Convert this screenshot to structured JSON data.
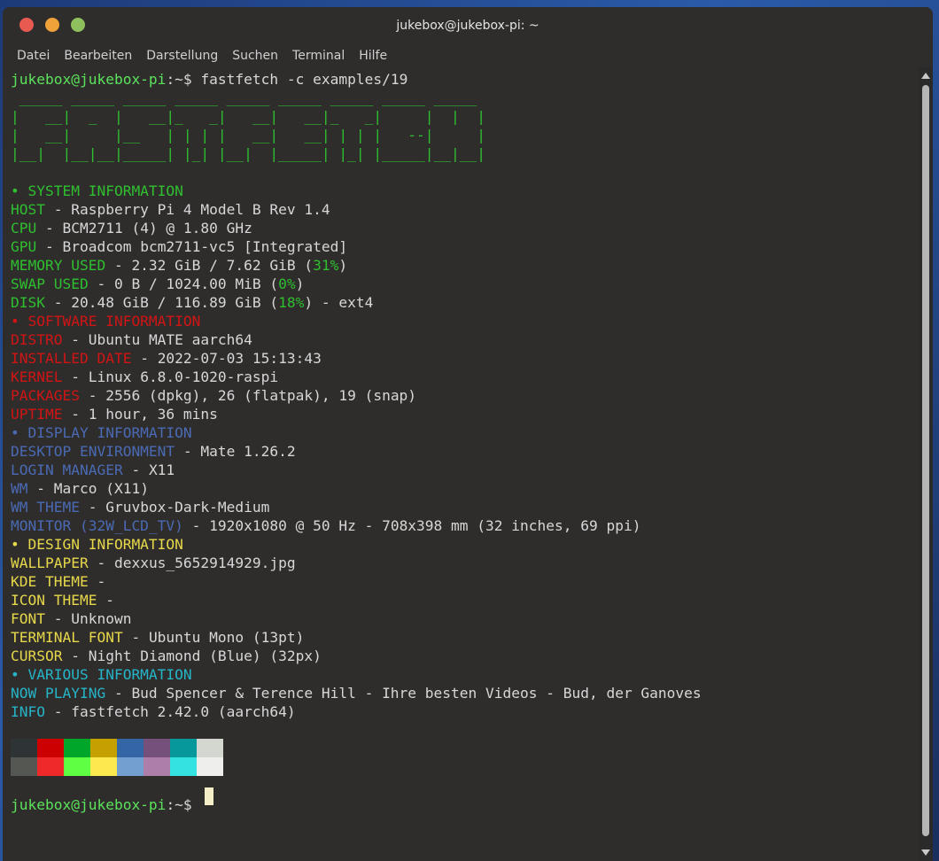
{
  "window": {
    "title": "jukebox@jukebox-pi: ~"
  },
  "menu": [
    "Datei",
    "Bearbeiten",
    "Darstellung",
    "Suchen",
    "Terminal",
    "Hilfe"
  ],
  "prompt": "jukebox@jukebox-pi",
  "prompt_suffix": ":~$",
  "command": "fastfetch -c examples/19",
  "logo": [
    " _____ _____ _____ _____ _____ _____ _____ _____ _____",
    "|   __|  _  |   __|_   _|   __|   __|_   _|     |  |  |",
    "|   __|     |__   | | | |   __|   __| | | |   --|     |",
    "|__|  |__|__|_____| |_| |__|  |_____| |_| |_____|__|__|"
  ],
  "sections": {
    "system": "• SYSTEM INFORMATION",
    "software": "• SOFTWARE INFORMATION",
    "display": "• DISPLAY INFORMATION",
    "design": "• DESIGN INFORMATION",
    "various": "• VARIOUS INFORMATION"
  },
  "host": {
    "key": "HOST",
    "val": " - Raspberry Pi 4 Model B Rev 1.4"
  },
  "cpu": {
    "key": "CPU",
    "val": " - BCM2711 (4) @ 1.80 GHz"
  },
  "gpu": {
    "key": "GPU",
    "val": " - Broadcom bcm2711-vc5 [Integrated]"
  },
  "memory": {
    "key": "MEMORY USED",
    "val": " - 2.32 GiB / 7.62 GiB (",
    "pct": "31%",
    "tail": ")"
  },
  "swap": {
    "key": "SWAP USED",
    "val": " - 0 B / 1024.00 MiB (",
    "pct": "0%",
    "tail": ")"
  },
  "disk": {
    "key": "DISK",
    "val": " - 20.48 GiB / 116.89 GiB (",
    "pct": "18%",
    "tail": ") - ext4"
  },
  "distro": {
    "key": "DISTRO",
    "val": " - Ubuntu MATE aarch64"
  },
  "installed": {
    "key": "INSTALLED DATE",
    "val": " - 2022-07-03 15:13:43"
  },
  "kernel": {
    "key": "KERNEL",
    "val": " - Linux 6.8.0-1020-raspi"
  },
  "packages": {
    "key": "PACKAGES",
    "val": " - 2556 (dpkg), 26 (flatpak), 19 (snap)"
  },
  "uptime": {
    "key": "UPTIME",
    "val": " - 1 hour, 36 mins"
  },
  "de": {
    "key": "DESKTOP ENVIRONMENT",
    "val": " - Mate 1.26.2"
  },
  "login": {
    "key": "LOGIN MANAGER",
    "val": " - X11"
  },
  "wm": {
    "key": "WM",
    "val": " - Marco (X11)"
  },
  "wmtheme": {
    "key": "WM THEME",
    "val": " - Gruvbox-Dark-Medium"
  },
  "monitor": {
    "key": "MONITOR (32W_LCD_TV)",
    "val": " - 1920x1080 @ 50 Hz - 708x398 mm (32 inches, 69 ppi)"
  },
  "wallpaper": {
    "key": "WALLPAPER",
    "val": " - dexxus_5652914929.jpg"
  },
  "kde": {
    "key": "KDE THEME",
    "val": " -"
  },
  "icon": {
    "key": "ICON THEME",
    "val": " -"
  },
  "font": {
    "key": "FONT",
    "val": " - Unknown"
  },
  "tfont": {
    "key": "TERMINAL FONT",
    "val": " - Ubuntu Mono (13pt)"
  },
  "cursor": {
    "key": "CURSOR",
    "val": " - Night Diamond (Blue) (32px)"
  },
  "playing": {
    "key": "NOW PLAYING",
    "val": " - Bud Spencer & Terence Hill - Ihre besten Videos - Bud, der Ganoves"
  },
  "info": {
    "key": "INFO",
    "val": " - fastfetch 2.42.0 (aarch64)"
  },
  "palette": {
    "row1": [
      "#2e3436",
      "#cc0000",
      "#00a62a",
      "#c4a000",
      "#3465a4",
      "#75507b",
      "#06989a",
      "#d3d7cf"
    ],
    "row2": [
      "#555753",
      "#ef2929",
      "#5fff44",
      "#fce94f",
      "#729fcf",
      "#ad7fa8",
      "#34e2e2",
      "#eeeeec"
    ]
  }
}
